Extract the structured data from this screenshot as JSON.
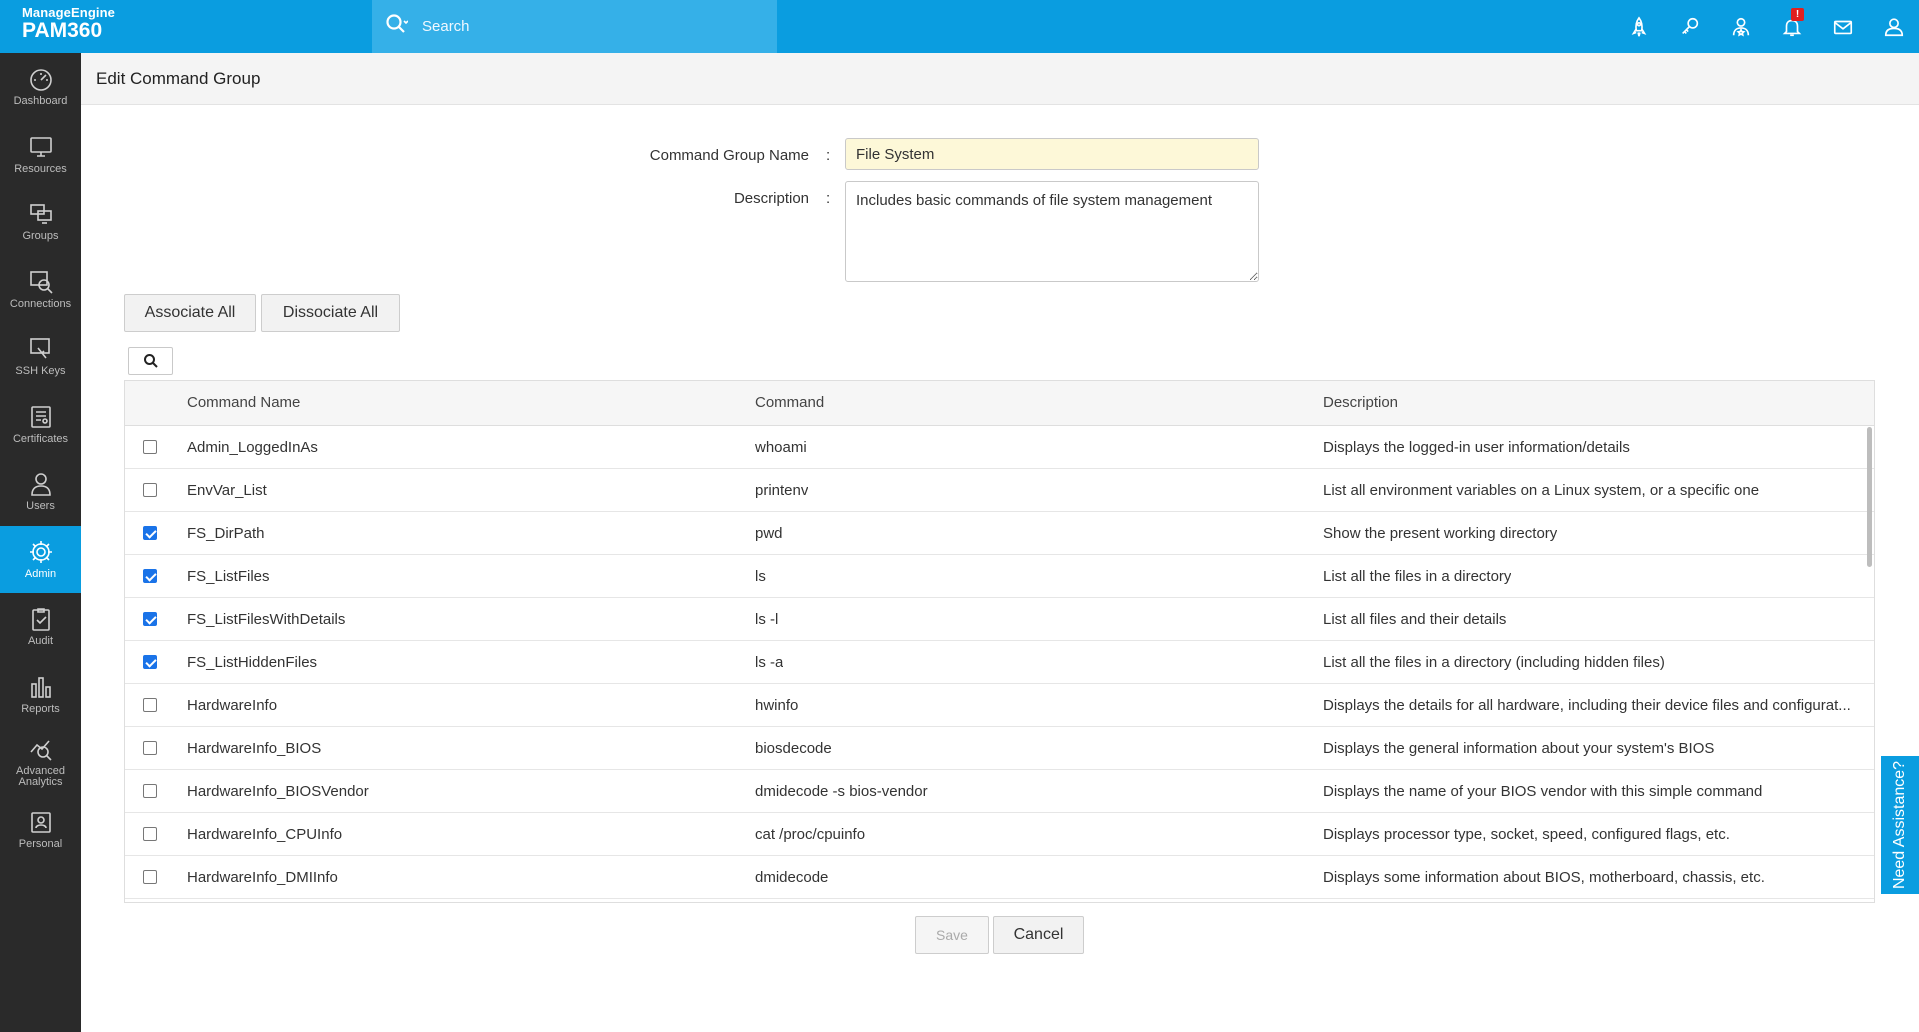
{
  "header": {
    "brand_small": "ManageEngine",
    "brand_big": "PAM360",
    "search_placeholder": "Search",
    "icons": [
      "rocket-icon",
      "key-link-icon",
      "user-star-icon",
      "bell-icon",
      "mail-icon",
      "user-icon"
    ],
    "notification_count": "!"
  },
  "sidebar": {
    "items": [
      {
        "label": "Dashboard",
        "icon": "dashboard-icon"
      },
      {
        "label": "Resources",
        "icon": "monitor-icon"
      },
      {
        "label": "Groups",
        "icon": "groups-icon"
      },
      {
        "label": "Connections",
        "icon": "connections-icon"
      },
      {
        "label": "SSH Keys",
        "icon": "ssh-keys-icon"
      },
      {
        "label": "Certificates",
        "icon": "certificates-icon"
      },
      {
        "label": "Users",
        "icon": "users-icon"
      },
      {
        "label": "Admin",
        "icon": "gear-icon"
      },
      {
        "label": "Audit",
        "icon": "audit-icon"
      },
      {
        "label": "Reports",
        "icon": "reports-icon"
      },
      {
        "label": "Advanced Analytics",
        "icon": "analytics-icon"
      },
      {
        "label": "Personal",
        "icon": "personal-icon"
      }
    ],
    "active": "Admin"
  },
  "page": {
    "title": "Edit Command Group"
  },
  "form": {
    "name_label": "Command Group Name",
    "name_value": "File System",
    "desc_label": "Description",
    "desc_value": "Includes basic commands of file system management",
    "colon": ":"
  },
  "actions": {
    "associate_all": "Associate All",
    "dissociate_all": "Dissociate All",
    "save": "Save",
    "cancel": "Cancel"
  },
  "table": {
    "columns": [
      "Command Name",
      "Command",
      "Description"
    ],
    "rows": [
      {
        "checked": false,
        "name": "Admin_LoggedInAs",
        "command": "whoami",
        "description": "Displays the logged-in user information/details"
      },
      {
        "checked": false,
        "name": "EnvVar_List",
        "command": "printenv",
        "description": "List all environment variables on a Linux system, or a specific one"
      },
      {
        "checked": true,
        "name": "FS_DirPath",
        "command": "pwd",
        "description": "Show the present working directory"
      },
      {
        "checked": true,
        "name": "FS_ListFiles",
        "command": "ls",
        "description": "List all the files in a directory"
      },
      {
        "checked": true,
        "name": "FS_ListFilesWithDetails",
        "command": "ls -l",
        "description": "List all files and their details"
      },
      {
        "checked": true,
        "name": "FS_ListHiddenFiles",
        "command": "ls -a",
        "description": "List all the files in a directory (including hidden files)"
      },
      {
        "checked": false,
        "name": "HardwareInfo",
        "command": "hwinfo",
        "description": "Displays the details for all hardware, including their device files and configurat..."
      },
      {
        "checked": false,
        "name": "HardwareInfo_BIOS",
        "command": "biosdecode",
        "description": "Displays the general information about your system's BIOS"
      },
      {
        "checked": false,
        "name": "HardwareInfo_BIOSVendor",
        "command": "dmidecode -s bios-vendor",
        "description": "Displays the name of your BIOS vendor with this simple command"
      },
      {
        "checked": false,
        "name": "HardwareInfo_CPUInfo",
        "command": "cat /proc/cpuinfo",
        "description": "Displays processor type, socket, speed, configured flags, etc."
      },
      {
        "checked": false,
        "name": "HardwareInfo_DMIInfo",
        "command": "dmidecode",
        "description": "Displays some information about BIOS, motherboard, chassis, etc."
      }
    ]
  },
  "help": {
    "label": "Need Assistance?"
  }
}
